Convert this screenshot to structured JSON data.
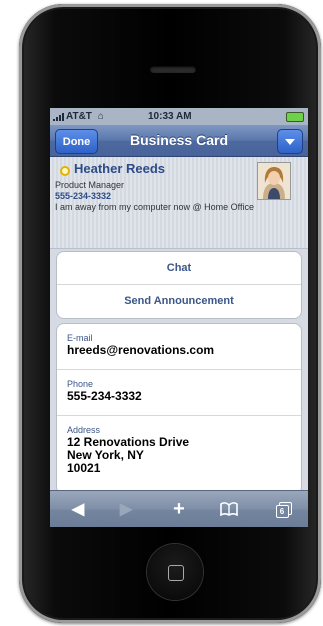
{
  "status_bar": {
    "carrier": "AT&T",
    "time": "10:33 AM"
  },
  "nav": {
    "done_label": "Done",
    "title": "Business Card"
  },
  "contact": {
    "name": "Heather Reeds",
    "role": "Product Manager",
    "phone": "555-234-3332",
    "status": "I am away from my computer now @ Home Office"
  },
  "actions": [
    {
      "label": "Chat"
    },
    {
      "label": "Send Announcement"
    }
  ],
  "details": {
    "email_label": "E-mail",
    "email": "hreeds@renovations.com",
    "phone_label": "Phone",
    "phone": "555-234-3332",
    "address_label": "Address",
    "address_line1": "12 Renovations Drive",
    "address_line2": "New York, NY",
    "address_line3": "10021"
  },
  "toolbar": {
    "tabs_count": "6",
    "icons": [
      "back-arrow-icon",
      "forward-arrow-icon",
      "plus-icon",
      "bookmarks-icon",
      "pages-icon"
    ]
  },
  "colors": {
    "nav_blue": "#4d6aa0",
    "link_blue": "#3b5688",
    "presence_yellow": "#e1b400"
  }
}
